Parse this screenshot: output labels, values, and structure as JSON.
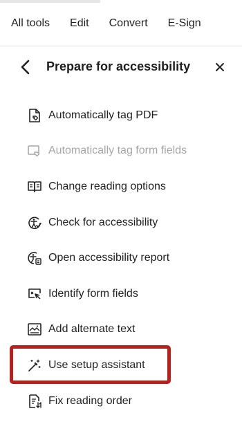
{
  "top_nav": {
    "items": [
      "All tools",
      "Edit",
      "Convert",
      "E-Sign"
    ]
  },
  "panel": {
    "title": "Prepare for accessibility",
    "back_icon": "chevron-left-icon",
    "close_icon": "close-icon"
  },
  "tools": [
    {
      "label": "Automatically tag PDF",
      "icon": "auto-tag-pdf-icon",
      "enabled": true
    },
    {
      "label": "Automatically tag form fields",
      "icon": "auto-tag-form-fields-icon",
      "enabled": false
    },
    {
      "label": "Change reading options",
      "icon": "book-reading-icon",
      "enabled": true
    },
    {
      "label": "Check for accessibility",
      "icon": "accessibility-check-icon",
      "enabled": true
    },
    {
      "label": "Open accessibility report",
      "icon": "accessibility-report-icon",
      "enabled": true
    },
    {
      "label": "Identify form fields",
      "icon": "identify-form-fields-icon",
      "enabled": true
    },
    {
      "label": "Add alternate text",
      "icon": "image-alt-text-icon",
      "enabled": true
    },
    {
      "label": "Use setup assistant",
      "icon": "magic-wand-icon",
      "enabled": true
    },
    {
      "label": "Fix reading order",
      "icon": "reading-order-icon",
      "enabled": true
    }
  ],
  "colors": {
    "highlight": "#b3221d",
    "disabled_text": "#a6a6a6",
    "text": "#222222"
  }
}
